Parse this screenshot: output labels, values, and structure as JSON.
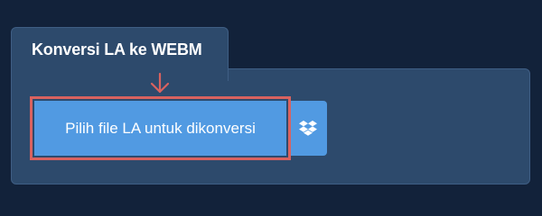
{
  "tab": {
    "title": "Konversi LA ke WEBM"
  },
  "upload": {
    "pick_file_label": "Pilih file LA untuk dikonversi",
    "dropbox_icon": "dropbox-icon"
  },
  "annotation": {
    "arrow_icon": "arrow-down-icon",
    "highlight_color": "#d9625f"
  },
  "colors": {
    "background": "#12223a",
    "panel": "#2d4a6c",
    "button": "#519ae2",
    "accent": "#d9625f"
  }
}
